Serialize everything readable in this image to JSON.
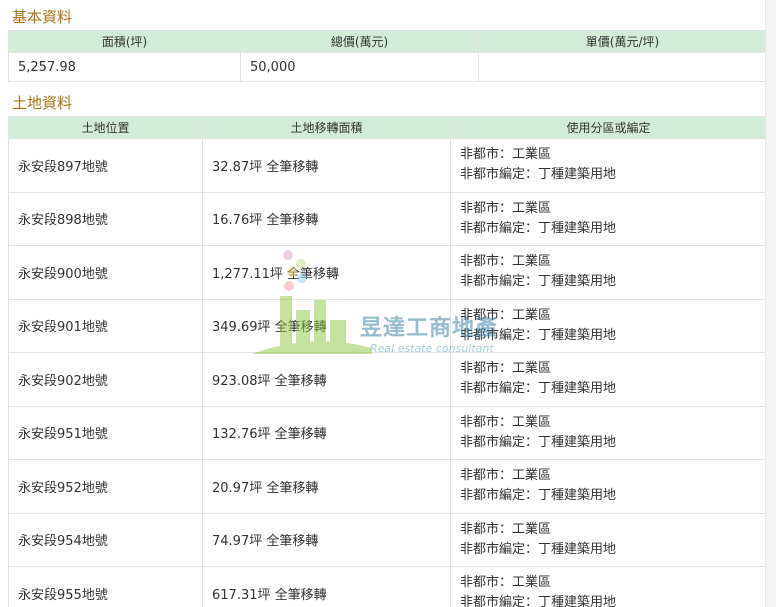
{
  "basic": {
    "title": "基本資料",
    "headers": [
      "面積(坪)",
      "總價(萬元)",
      "單價(萬元/坪)"
    ],
    "row": [
      "5,257.98",
      "50,000",
      ""
    ]
  },
  "land": {
    "title": "土地資料",
    "headers": [
      "土地位置",
      "土地移轉面積",
      "使用分區或編定"
    ],
    "rows": [
      {
        "location": "永安段897地號",
        "area": "32.87坪 全筆移轉",
        "zone1": "非都市：工業區",
        "zone2": "非都市編定：丁種建築用地"
      },
      {
        "location": "永安段898地號",
        "area": "16.76坪 全筆移轉",
        "zone1": "非都市：工業區",
        "zone2": "非都市編定：丁種建築用地"
      },
      {
        "location": "永安段900地號",
        "area": "1,277.11坪 全筆移轉",
        "zone1": "非都市：工業區",
        "zone2": "非都市編定：丁種建築用地"
      },
      {
        "location": "永安段901地號",
        "area": "349.69坪 全筆移轉",
        "zone1": "非都市：工業區",
        "zone2": "非都市編定：丁種建築用地"
      },
      {
        "location": "永安段902地號",
        "area": "923.08坪 全筆移轉",
        "zone1": "非都市：工業區",
        "zone2": "非都市編定：丁種建築用地"
      },
      {
        "location": "永安段951地號",
        "area": "132.76坪 全筆移轉",
        "zone1": "非都市：工業區",
        "zone2": "非都市編定：丁種建築用地"
      },
      {
        "location": "永安段952地號",
        "area": "20.97坪 全筆移轉",
        "zone1": "非都市：工業區",
        "zone2": "非都市編定：丁種建築用地"
      },
      {
        "location": "永安段954地號",
        "area": "74.97坪 全筆移轉",
        "zone1": "非都市：工業區",
        "zone2": "非都市編定：丁種建築用地"
      },
      {
        "location": "永安段955地號",
        "area": "617.31坪 全筆移轉",
        "zone1": "非都市：工業區",
        "zone2": "非都市編定：丁種建築用地"
      }
    ]
  },
  "watermark": {
    "name_cn": "昱達工商地產",
    "name_en": "Real estate consultant",
    "colors": {
      "green": "#8cc63f",
      "blue": "#2d7b9e"
    }
  }
}
